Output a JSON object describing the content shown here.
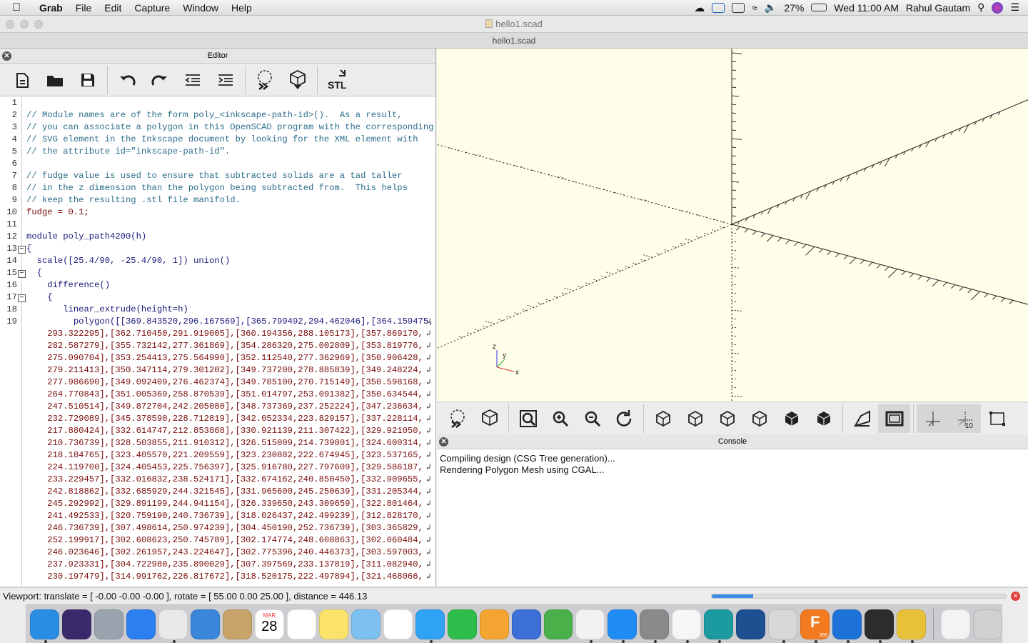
{
  "menubar": {
    "app_name": "Grab",
    "menus": [
      "File",
      "Edit",
      "Capture",
      "Window",
      "Help"
    ],
    "battery": "27%",
    "clock": "Wed 11:00 AM",
    "user": "Rahul Gautam"
  },
  "window": {
    "title": "hello1.scad",
    "tab": "hello1.scad"
  },
  "editor": {
    "title": "Editor",
    "toolbar": [
      "new-file",
      "open-file",
      "save",
      "undo",
      "redo",
      "unindent",
      "indent",
      "preview",
      "render",
      "export-stl"
    ],
    "stl_label": "STL",
    "lines": [
      {
        "n": "1",
        "t": "",
        "c": ""
      },
      {
        "n": "2",
        "t": "// Module names are of the form poly_<inkscape-path-id>().  As a result,",
        "c": "cm"
      },
      {
        "n": "3",
        "t": "// you can associate a polygon in this OpenSCAD program with the corresponding",
        "c": "cm"
      },
      {
        "n": "4",
        "t": "// SVG element in the Inkscape document by looking for the XML element with",
        "c": "cm"
      },
      {
        "n": "5",
        "t": "// the attribute id=\"inkscape-path-id\".",
        "c": "cm"
      },
      {
        "n": "6",
        "t": "",
        "c": ""
      },
      {
        "n": "7",
        "t": "// fudge value is used to ensure that subtracted solids are a tad taller",
        "c": "cm"
      },
      {
        "n": "8",
        "t": "// in the z dimension than the polygon being subtracted from.  This helps",
        "c": "cm"
      },
      {
        "n": "9",
        "t": "// keep the resulting .stl file manifold.",
        "c": "cm"
      },
      {
        "n": "10",
        "t": "fudge = 0.1;",
        "c": "num"
      },
      {
        "n": "11",
        "t": "",
        "c": ""
      },
      {
        "n": "12",
        "t": "module poly_path4200(h)",
        "c": "kw"
      },
      {
        "n": "13",
        "t": "{",
        "c": "kw"
      },
      {
        "n": "14",
        "t": "  scale([25.4/90, -25.4/90, 1]) union()",
        "c": "kw"
      },
      {
        "n": "15",
        "t": "  {",
        "c": "kw"
      },
      {
        "n": "16",
        "t": "    difference()",
        "c": "kw"
      },
      {
        "n": "17",
        "t": "    {",
        "c": "kw"
      },
      {
        "n": "18",
        "t": "       linear_extrude(height=h)",
        "c": "kw"
      },
      {
        "n": "19",
        "t": "         polygon([[369.843520,296.167569],[365.799492,294.462046],[364.159475,",
        "c": "kw"
      },
      {
        "n": "",
        "t": "    293.322295],[362.710450,291.919005],[360.194356,288.105173],[357.869170,",
        "c": "num"
      },
      {
        "n": "",
        "t": "    282.587279],[355.732142,277.361869],[354.286320,275.002809],[353.819776,",
        "c": "num"
      },
      {
        "n": "",
        "t": "    275.090704],[353.254413,275.564990],[352.112540,277.362969],[350.906428,",
        "c": "num"
      },
      {
        "n": "",
        "t": "    279.211413],[350.347114,279.301202],[349.737200,278.885839],[349.248224,",
        "c": "num"
      },
      {
        "n": "",
        "t": "    277.986690],[349.092409,276.462374],[349.785100,270.715149],[350.598168,",
        "c": "num"
      },
      {
        "n": "",
        "t": "    264.770843],[351.005369,258.870539],[351.014797,253.091382],[350.634544,",
        "c": "num"
      },
      {
        "n": "",
        "t": "    247.510514],[349.872704,242.205080],[348.737369,237.252224],[347.236634,",
        "c": "num"
      },
      {
        "n": "",
        "t": "    232.729089],[345.378590,228.712819],[342.052334,223.829157],[337.228114,",
        "c": "num"
      },
      {
        "n": "",
        "t": "    217.880424],[332.614747,212.853868],[330.921139,211.307422],[329.921050,",
        "c": "num"
      },
      {
        "n": "",
        "t": "    210.736739],[328.503855,211.910312],[326.515009,214.739001],[324.600314,",
        "c": "num"
      },
      {
        "n": "",
        "t": "    218.184765],[323.405570,221.209559],[323.230882,222.674945],[323.537165,",
        "c": "num"
      },
      {
        "n": "",
        "t": "    224.119700],[324.405453,225.756397],[325.916780,227.797609],[329.586187,",
        "c": "num"
      },
      {
        "n": "",
        "t": "    233.229457],[332.016832,238.524171],[332.674162,240.850450],[332.909655,",
        "c": "num"
      },
      {
        "n": "",
        "t": "    242.818862],[332.685929,244.321545],[331.965600,245.250639],[331.205344,",
        "c": "num"
      },
      {
        "n": "",
        "t": "    245.292992],[329.891199,244.941154],[326.339650,243.309659],[322.801464,",
        "c": "num"
      },
      {
        "n": "",
        "t": "    241.492533],[320.759190,240.736739],[318.026437,242.499239],[312.828170,",
        "c": "num"
      },
      {
        "n": "",
        "t": "    246.736739],[307.498614,250.974239],[304.450190,252.736739],[303.365829,",
        "c": "num"
      },
      {
        "n": "",
        "t": "    252.199917],[302.608623,250.745789],[302.174774,248.608863],[302.060484,",
        "c": "num"
      },
      {
        "n": "",
        "t": "    246.023646],[302.261957,243.224647],[302.775396,240.446373],[303.597003,",
        "c": "num"
      },
      {
        "n": "",
        "t": "    237.923331],[304.722980,235.890029],[307.397569,233.137819],[311.082940,",
        "c": "num"
      },
      {
        "n": "",
        "t": "    230.197479],[314.991762,226.817672],[318.520175,222.497894],[321.468066,",
        "c": "num"
      }
    ]
  },
  "viewport": {
    "axis_label_x": "x",
    "axis_label_y": "y",
    "axis_label_z": "z",
    "background_color": "#fffee8"
  },
  "view_toolbar": [
    "preview",
    "render",
    "view-all",
    "zoom-in",
    "zoom-out",
    "reset-view",
    "view-right",
    "view-top",
    "view-bottom",
    "view-left",
    "view-front",
    "view-back",
    "perspective",
    "orthogonal",
    "show-axes",
    "show-scale-markers",
    "show-edges"
  ],
  "scale_marker_label": "10",
  "console": {
    "title": "Console",
    "messages": [
      "Compiling design (CSG Tree generation)...",
      "Rendering Polygon Mesh using CGAL..."
    ]
  },
  "status": {
    "text": "Viewport: translate = [ -0.00 -0.00 -0.00 ], rotate = [ 55.00 0.00 25.00 ], distance = 446.13",
    "progress": 0.14
  },
  "dock": {
    "items": [
      "finder",
      "siri",
      "launchpad",
      "safari",
      "chrome",
      "mail",
      "contacts",
      "calendar",
      "reminders",
      "notes",
      "maps",
      "photos",
      "messages",
      "facetime",
      "pages",
      "keynote",
      "numbers",
      "itunes",
      "app-store",
      "system-preferences",
      "vlc",
      "arduino",
      "bbedit",
      "grab",
      "fusion-360",
      "teamviewer",
      "xquartz",
      "openscad",
      "documents",
      "trash"
    ],
    "calendar_month": "MAR",
    "calendar_day": "28",
    "fusion_label": "360"
  }
}
